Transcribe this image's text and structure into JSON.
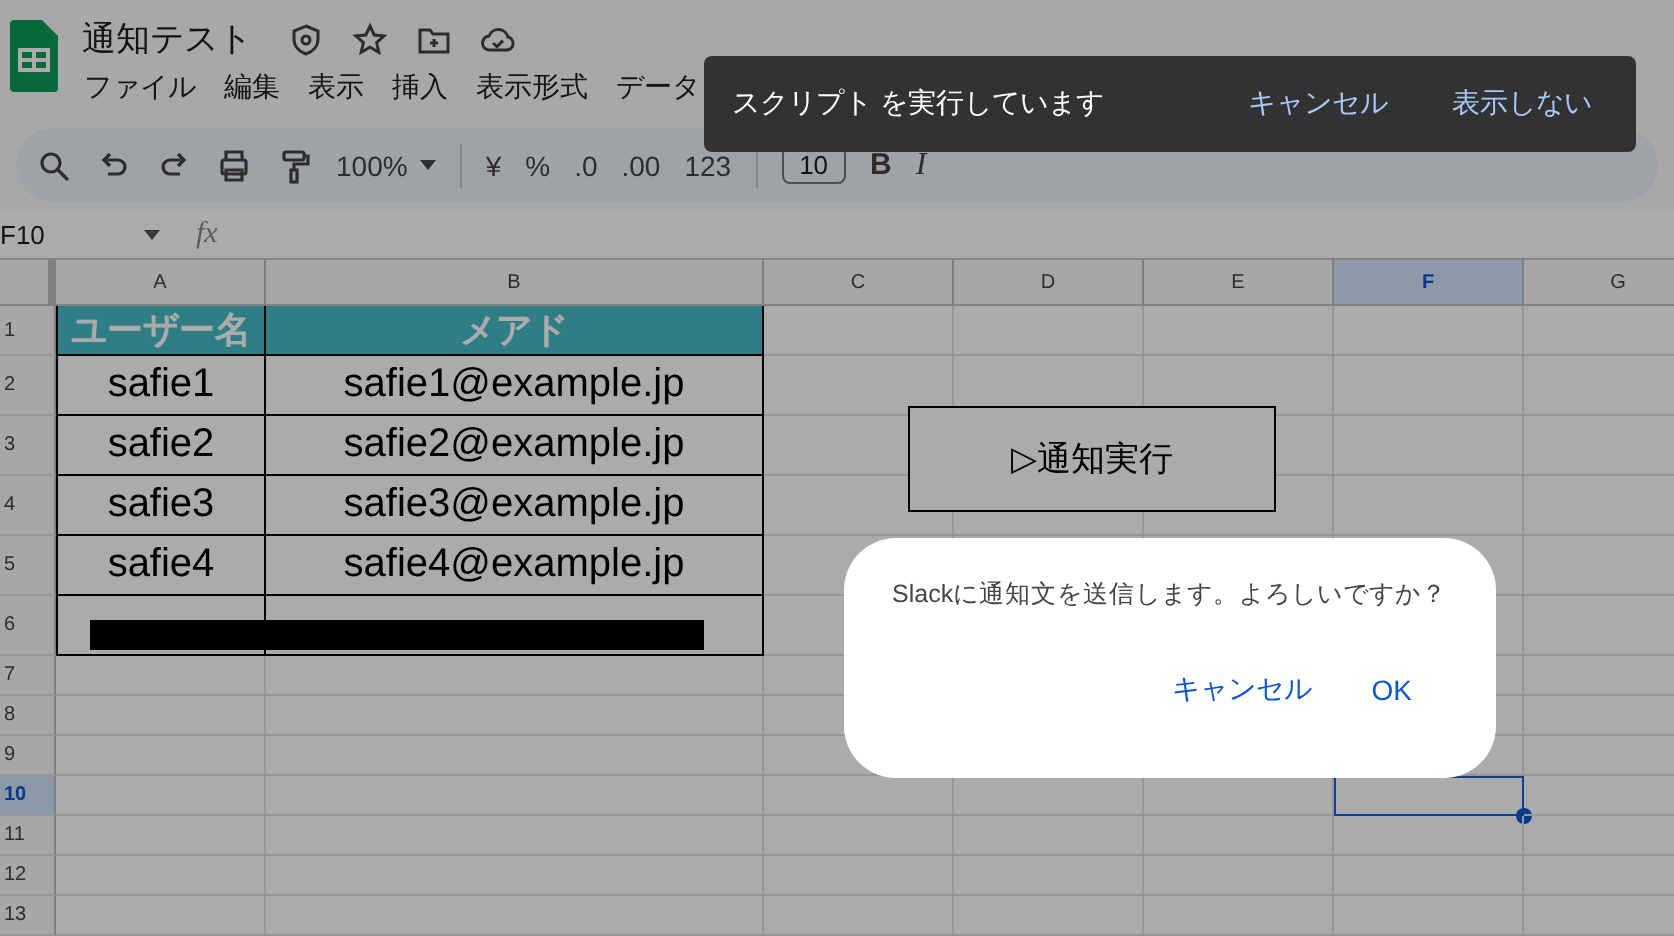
{
  "app": {
    "title": "通知テスト",
    "menu": [
      "ファイル",
      "編集",
      "表示",
      "挿入",
      "表示形式",
      "データ"
    ]
  },
  "toolbar": {
    "zoom": "100%",
    "items": [
      {
        "kind": "text",
        "label": "¥"
      },
      {
        "kind": "text",
        "label": "%"
      },
      {
        "kind": "text",
        "label": ".0"
      },
      {
        "kind": "text",
        "label": ".00"
      },
      {
        "kind": "text",
        "label": "123"
      },
      {
        "kind": "divider"
      },
      {
        "kind": "size",
        "label": "10"
      },
      {
        "kind": "bold",
        "label": "B"
      },
      {
        "kind": "italic",
        "label": "I"
      }
    ]
  },
  "formula_bar": {
    "cell_ref": "F10",
    "fx": "fx"
  },
  "sheet": {
    "columns": [
      {
        "label": "A",
        "selected": false
      },
      {
        "label": "B",
        "selected": false
      },
      {
        "label": "C",
        "selected": false
      },
      {
        "label": "D",
        "selected": false
      },
      {
        "label": "E",
        "selected": false
      },
      {
        "label": "F",
        "selected": true
      },
      {
        "label": "G",
        "selected": false
      }
    ],
    "rows": [
      {
        "label": "1",
        "selected": false,
        "kind": "header",
        "cells": [
          "ユーザー名",
          "メアド"
        ]
      },
      {
        "label": "2",
        "selected": false,
        "kind": "data",
        "cells": [
          "safie1",
          "safie1@example.jp"
        ]
      },
      {
        "label": "3",
        "selected": false,
        "kind": "data",
        "cells": [
          "safie2",
          "safie2@example.jp"
        ]
      },
      {
        "label": "4",
        "selected": false,
        "kind": "data",
        "cells": [
          "safie3",
          "safie3@example.jp"
        ]
      },
      {
        "label": "5",
        "selected": false,
        "kind": "data",
        "cells": [
          "safie4",
          "safie4@example.jp"
        ]
      },
      {
        "label": "6",
        "selected": false,
        "kind": "redacted"
      },
      {
        "label": "7",
        "selected": false,
        "kind": "empty"
      },
      {
        "label": "8",
        "selected": false,
        "kind": "empty"
      },
      {
        "label": "9",
        "selected": false,
        "kind": "empty"
      },
      {
        "label": "10",
        "selected": true,
        "kind": "empty"
      },
      {
        "label": "11",
        "selected": false,
        "kind": "empty"
      },
      {
        "label": "12",
        "selected": false,
        "kind": "empty"
      },
      {
        "label": "13",
        "selected": false,
        "kind": "empty"
      }
    ]
  },
  "drawing_button": {
    "label": "▷通知実行"
  },
  "toast": {
    "message": "スクリプト を実行しています",
    "actions": [
      "キャンセル",
      "表示しない"
    ]
  },
  "dialog": {
    "message": "Slackに通知文を送信します。よろしいですか？",
    "buttons": [
      "キャンセル",
      "OK"
    ]
  }
}
